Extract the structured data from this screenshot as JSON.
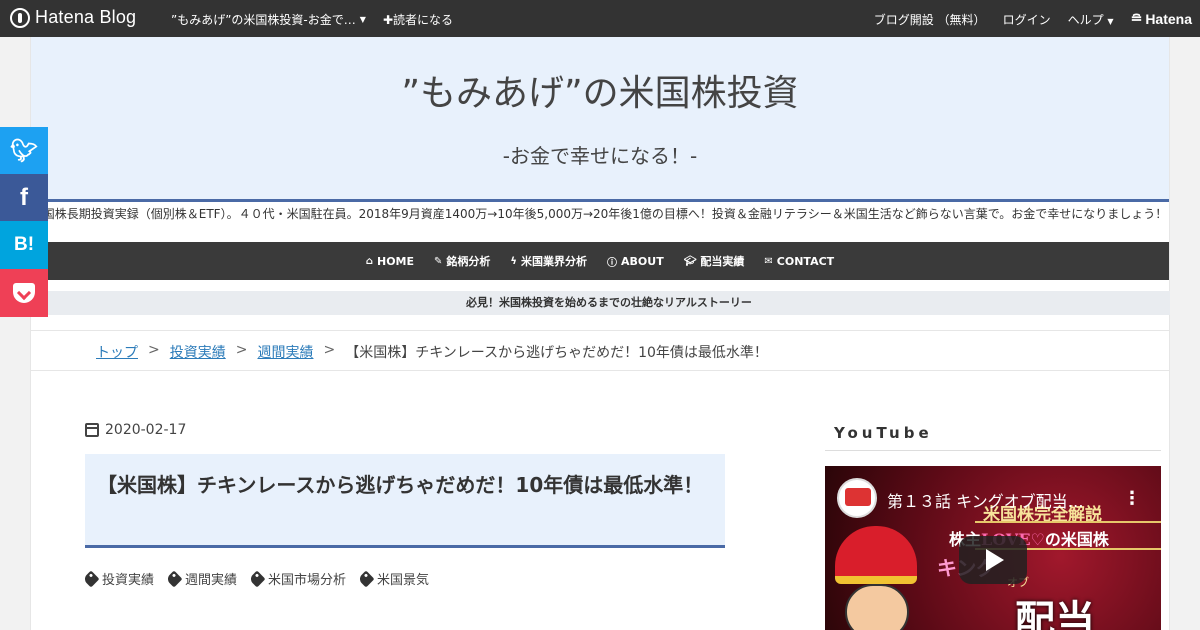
{
  "topbar": {
    "logo_text": "Hatena Blog",
    "blog_name": "”もみあげ”の米国株投資-お金で…",
    "follow_label": "✚読者になる",
    "links": [
      "ブログ開設 （無料）",
      "ログイン",
      "ヘルプ"
    ],
    "hatena_text": "Hatena"
  },
  "header": {
    "title": "”もみあげ”の米国株投資",
    "subtitle": "-お金で幸せになる！-",
    "description": "国株長期投資実録（個別株＆ETF）。４０代・米国駐在員。2018年9月資産1400万→10年後5,000万→20年後1億の目標へ！投資＆金融リテラシー＆米国生活など飾らない言葉で。お金で幸せになりましょう！"
  },
  "nav": {
    "items": [
      {
        "icon": "home-icon",
        "label": "HOME"
      },
      {
        "icon": "wrench-icon",
        "label": "銘柄分析"
      },
      {
        "icon": "bolt-icon",
        "label": "米国業界分析"
      },
      {
        "icon": "info-icon",
        "label": "ABOUT"
      },
      {
        "icon": "graduation-cap-icon",
        "label": "配当実績"
      },
      {
        "icon": "envelope-icon",
        "label": "CONTACT"
      }
    ]
  },
  "banner": "必見！米国株投資を始めるまでの壮絶なリアルストーリー",
  "breadcrumb": {
    "items": [
      "トップ",
      "投資実績",
      "週間実績"
    ],
    "separator": ">",
    "current": "【米国株】チキンレースから逃げちゃだめだ！10年債は最低水準！"
  },
  "share": {
    "twitter_icon": "twitter-icon",
    "facebook_label": "f",
    "hatebu_label": "B!",
    "pocket_icon": "pocket-icon"
  },
  "article": {
    "date": "2020-02-17",
    "title": "【米国株】チキンレースから逃げちゃだめだ！10年債は最低水準！",
    "tags": [
      "投資実績",
      "週間実績",
      "米国市場分析",
      "米国景気"
    ]
  },
  "sidebar": {
    "module_title": "YouTube",
    "video": {
      "title": "第１３話 キングオブ配当…",
      "line1": "米国株完全解説",
      "line2_a": "株主",
      "line2_love": "LOVE♡",
      "line2_b": "の米国株",
      "king": "キング",
      "of": "オブ",
      "big": "配当"
    }
  },
  "colors": {
    "topbar": "#333333",
    "header_bg": "#e8f1fc",
    "accent": "#4a6aa6",
    "nav_bg": "#3a3a3a",
    "twitter": "#1da1f2",
    "facebook": "#3b5998",
    "hatebu": "#00a4de",
    "pocket": "#ef4056",
    "link": "#2b7bb9"
  }
}
